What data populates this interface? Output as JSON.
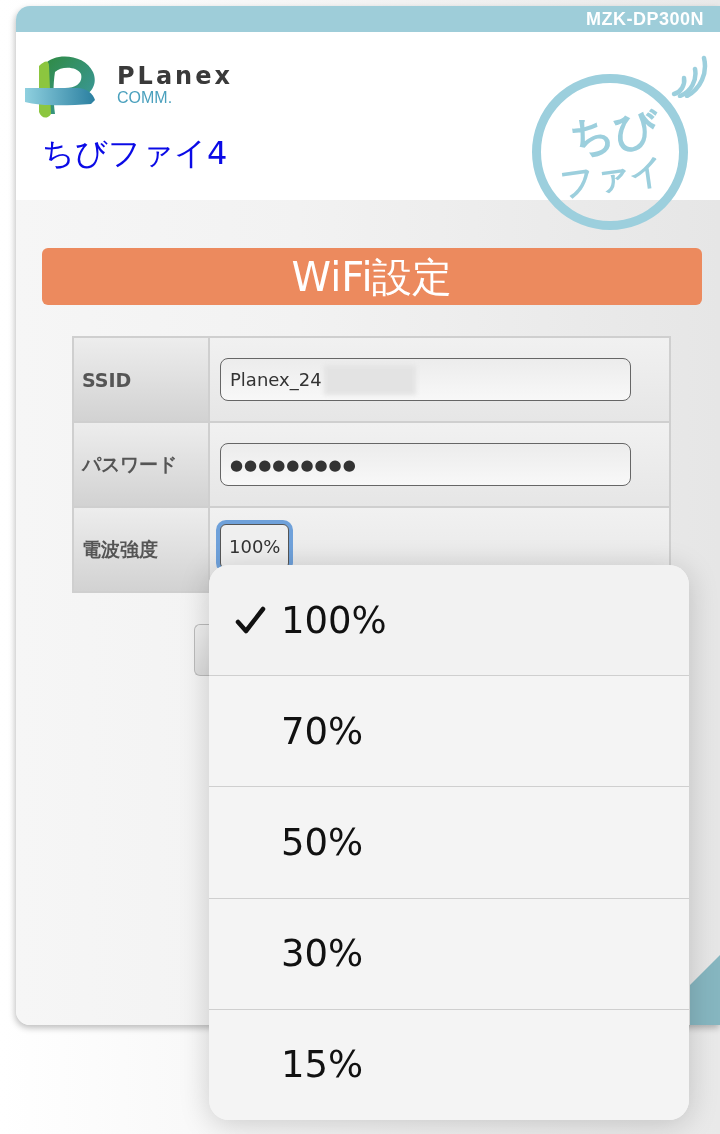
{
  "header": {
    "model": "MZK-DP300N"
  },
  "brand": {
    "logo_word": "PLanex",
    "logo_sub": "COMM.",
    "product_name": "ちびファイ4",
    "badge_lines": [
      "ちび",
      "ファイ"
    ]
  },
  "section_title": "WiFi設定",
  "form": {
    "rows": [
      {
        "kind": "text",
        "label": "SSID",
        "value": "Planex_24",
        "redacted": true
      },
      {
        "kind": "password",
        "label": "パスワード",
        "value": "●●●●●●●●●"
      },
      {
        "kind": "select",
        "label": "電波強度",
        "value": "100%",
        "focused": true
      }
    ]
  },
  "dropdown": {
    "options": [
      {
        "label": "100%",
        "selected": true
      },
      {
        "label": "70%",
        "selected": false
      },
      {
        "label": "50%",
        "selected": false
      },
      {
        "label": "30%",
        "selected": false
      },
      {
        "label": "15%",
        "selected": false
      }
    ]
  }
}
